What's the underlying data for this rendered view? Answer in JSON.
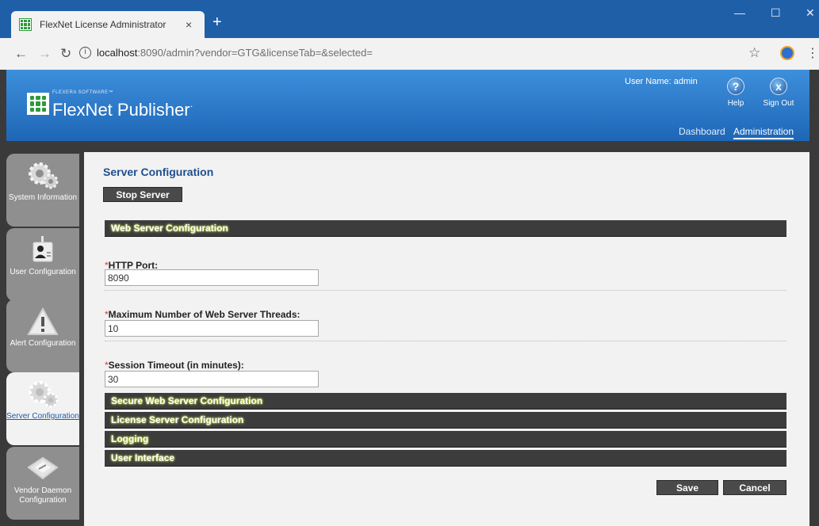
{
  "browser": {
    "tab_title": "FlexNet License Administrator",
    "tab_close": "×",
    "new_tab": "+",
    "url_host": "localhost",
    "url_rest": ":8090/admin?vendor=GTG&licenseTab=&selected=",
    "window_controls": [
      "—",
      "☐",
      "✕"
    ]
  },
  "header": {
    "brand_small": "FLEXERA SOFTWARE™",
    "brand": "FlexNet Publisher",
    "brand_mark": "·",
    "user_name": "User Name: admin",
    "help_label": "Help",
    "signout_label": "Sign Out",
    "nav": {
      "dashboard": "Dashboard",
      "administration": "Administration"
    },
    "accent_color": "#1e66b6"
  },
  "sidebar": {
    "items": [
      {
        "label": "System Information",
        "icon": "gears-icon"
      },
      {
        "label": "User Configuration",
        "icon": "user-badge-icon"
      },
      {
        "label": "Alert Configuration",
        "icon": "warning-icon"
      },
      {
        "label": "Server Configuration",
        "icon": "gears-icon",
        "active": true
      },
      {
        "label": "Vendor Daemon Configuration",
        "icon": "certificate-icon"
      }
    ]
  },
  "main": {
    "title": "Server Configuration",
    "stop_button": "Stop Server",
    "sections": {
      "web_server": "Web Server Configuration",
      "secure_web_server": "Secure Web Server Configuration",
      "license_server": "License Server Configuration",
      "logging": "Logging",
      "user_interface": "User Interface"
    },
    "required_mark": "*",
    "fields": {
      "http_port": {
        "label": "HTTP Port:",
        "value": "8090"
      },
      "max_threads": {
        "label": "Maximum Number of Web Server Threads:",
        "value": "10"
      },
      "session_timeout": {
        "label": "Session Timeout (in minutes):",
        "value": "30"
      }
    },
    "save_button": "Save",
    "cancel_button": "Cancel"
  }
}
